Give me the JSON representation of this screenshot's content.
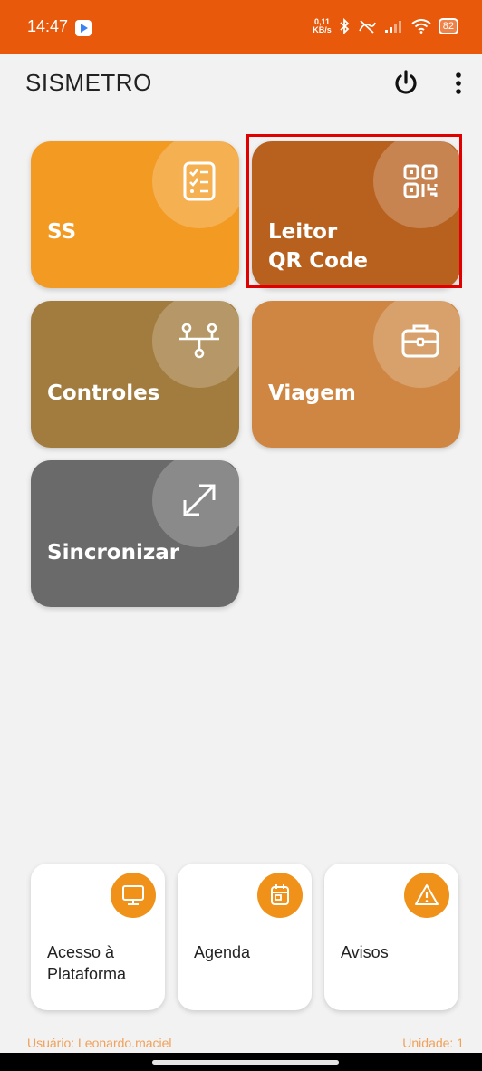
{
  "status_bar": {
    "time": "14:47",
    "net_speed_value": "0,11",
    "net_speed_unit": "KB/s",
    "battery": "82",
    "icons": [
      "app-notification-icon",
      "bluetooth-icon",
      "no-sim-icon",
      "signal-icon",
      "wifi-icon",
      "battery-icon"
    ]
  },
  "app_bar": {
    "title": "SISMETRO",
    "actions": [
      "power-icon",
      "more-vert-icon"
    ]
  },
  "tiles": [
    {
      "label": "SS",
      "icon": "checklist-icon",
      "color": "#f39a22"
    },
    {
      "label_line1": "Leitor",
      "label_line2": "QR Code",
      "icon": "qr-code-icon",
      "color": "#b8611f"
    },
    {
      "label": "Controles",
      "icon": "flow-branch-icon",
      "color": "#a27c3e"
    },
    {
      "label": "Viagem",
      "icon": "briefcase-icon",
      "color": "#ce8642"
    },
    {
      "label": "Sincronizar",
      "icon": "expand-arrows-icon",
      "color": "#6a6a6a"
    }
  ],
  "cards": [
    {
      "label_line1": "Acesso à",
      "label_line2": "Plataforma",
      "icon": "monitor-icon"
    },
    {
      "label": "Agenda",
      "icon": "calendar-icon"
    },
    {
      "label": "Avisos",
      "icon": "warning-icon"
    }
  ],
  "footer": {
    "user": "Usuário: Leonardo.maciel",
    "unit": "Unidade: 1"
  },
  "colors": {
    "status_bar": "#e8590c",
    "accent": "#f0921a",
    "highlight": "#e10000",
    "background": "#f2f2f2"
  }
}
